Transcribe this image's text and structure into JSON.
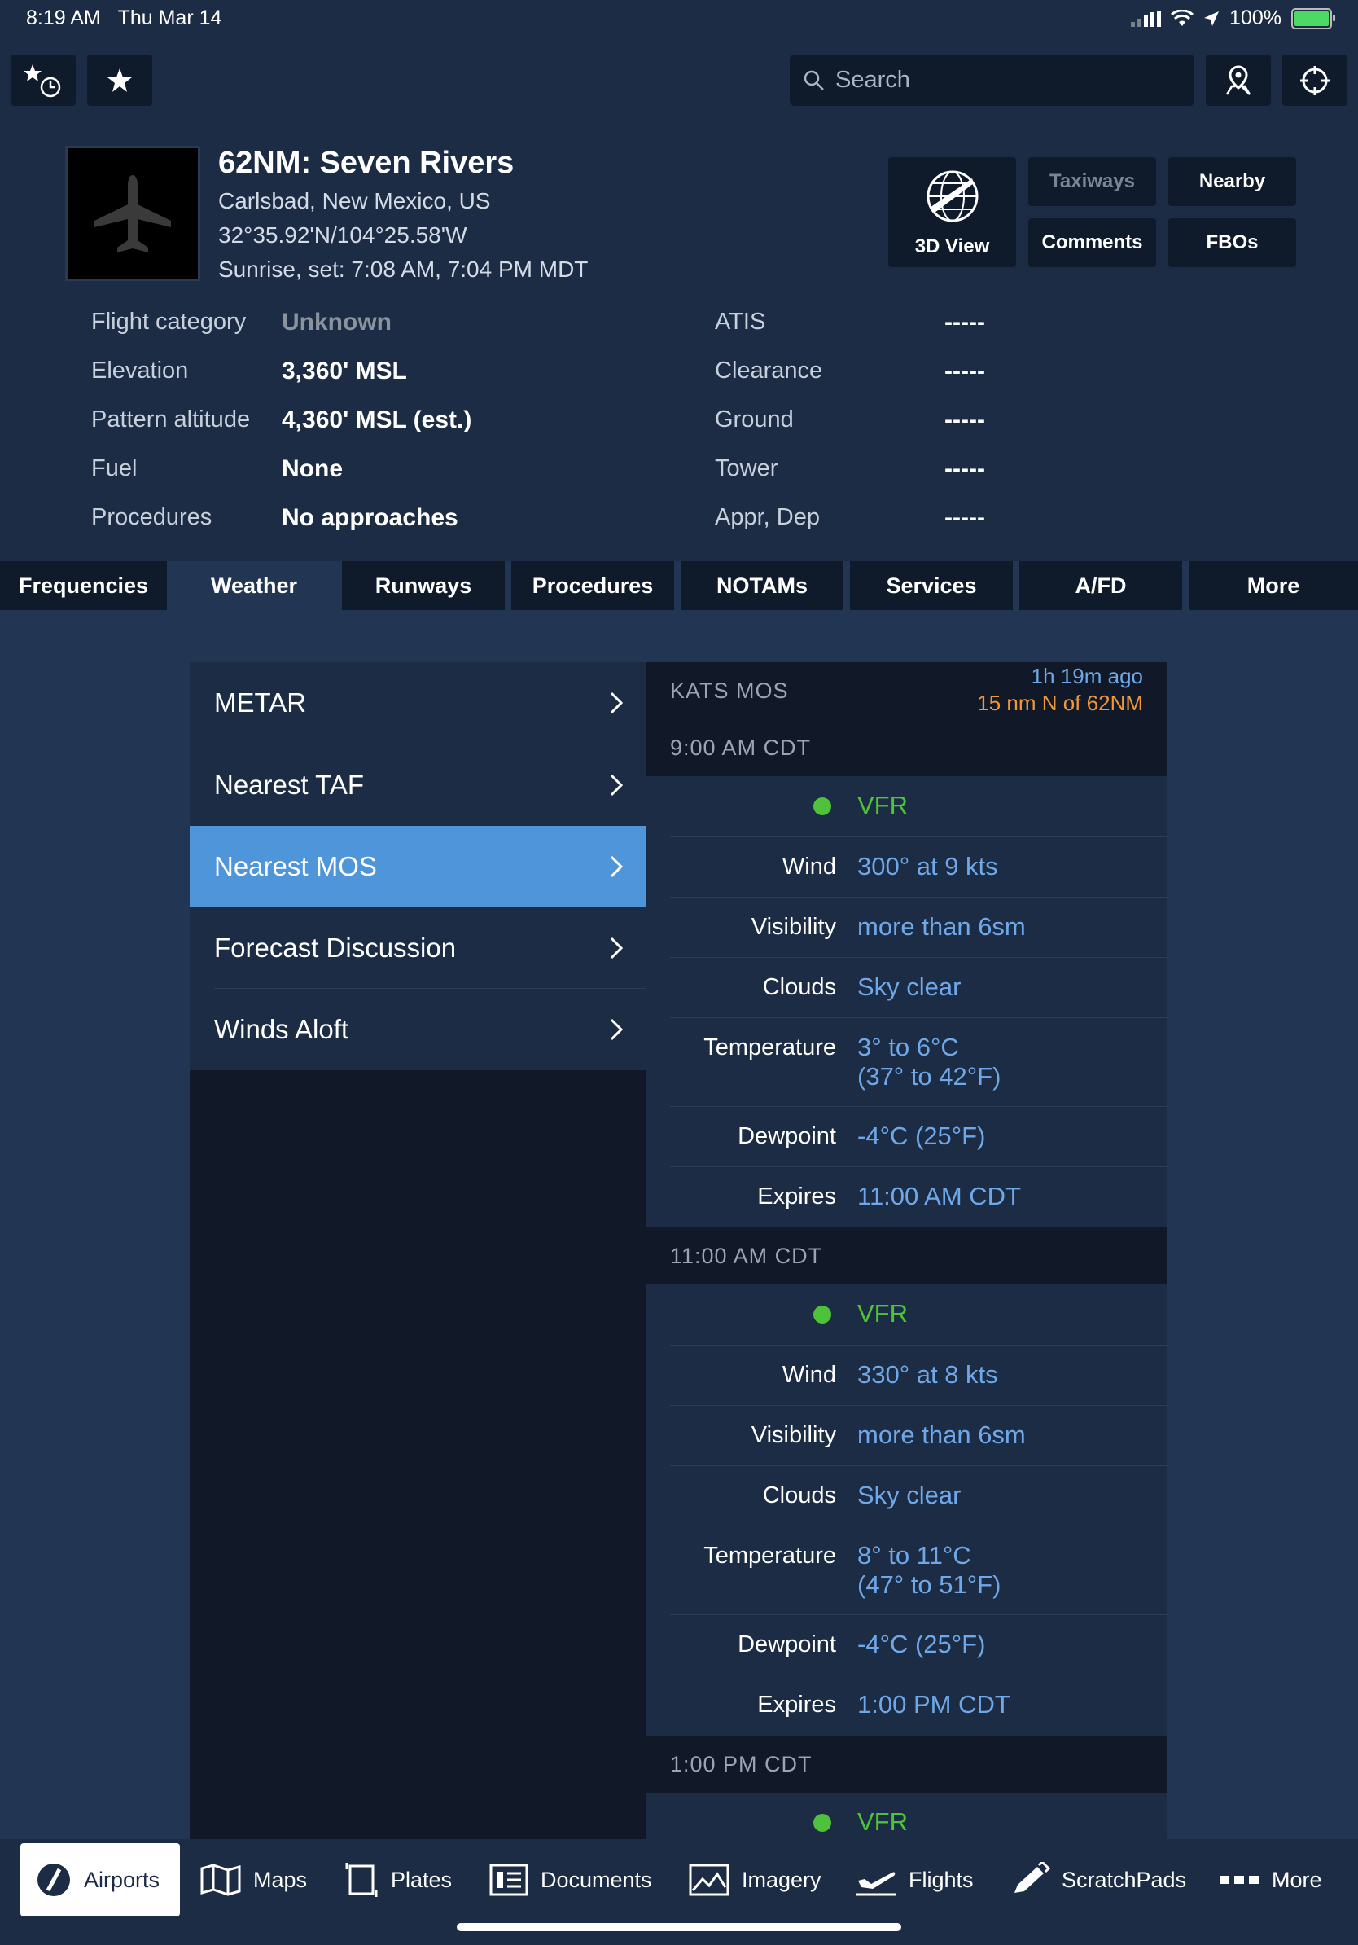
{
  "status": {
    "time": "8:19 AM",
    "date": "Thu Mar 14",
    "battery": "100%"
  },
  "toolbar": {
    "search_placeholder": "Search"
  },
  "airport": {
    "title": "62NM: Seven Rivers",
    "location": "Carlsbad, New Mexico, US",
    "coords": "32°35.92'N/104°25.58'W",
    "sun": "Sunrise, set: 7:08 AM, 7:04 PM MDT"
  },
  "header_buttons": {
    "view3d": "3D View",
    "taxiways": "Taxiways",
    "nearby": "Nearby",
    "comments": "Comments",
    "fbos": "FBOs"
  },
  "info_left": [
    {
      "label": "Flight category",
      "value": "Unknown"
    },
    {
      "label": "Elevation",
      "value": "3,360' MSL"
    },
    {
      "label": "Pattern altitude",
      "value": "4,360' MSL (est.)"
    },
    {
      "label": "Fuel",
      "value": "None"
    },
    {
      "label": "Procedures",
      "value": "No approaches"
    }
  ],
  "info_right": [
    {
      "label": "ATIS",
      "value": "-----"
    },
    {
      "label": "Clearance",
      "value": "-----"
    },
    {
      "label": "Ground",
      "value": "-----"
    },
    {
      "label": "Tower",
      "value": "-----"
    },
    {
      "label": "Appr, Dep",
      "value": "-----"
    }
  ],
  "tabs": [
    "Frequencies",
    "Weather",
    "Runways",
    "Procedures",
    "NOTAMs",
    "Services",
    "A/FD",
    "More"
  ],
  "weather_menu": [
    "METAR",
    "Nearest TAF",
    "Nearest MOS",
    "Forecast Discussion",
    "Winds Aloft"
  ],
  "mos": {
    "station": "KATS MOS",
    "age": "1h 19m ago",
    "distance": "15 nm N of 62NM",
    "periods": [
      {
        "time": "9:00 AM CDT",
        "category": "VFR",
        "wind": "300° at 9 kts",
        "visibility": "more than 6sm",
        "clouds": "Sky clear",
        "temp1": "3° to 6°C",
        "temp2": "(37° to 42°F)",
        "dewpoint": "-4°C (25°F)",
        "expires": "11:00 AM CDT"
      },
      {
        "time": "11:00 AM CDT",
        "category": "VFR",
        "wind": "330° at 8 kts",
        "visibility": "more than 6sm",
        "clouds": "Sky clear",
        "temp1": "8° to 11°C",
        "temp2": "(47° to 51°F)",
        "dewpoint": "-4°C (25°F)",
        "expires": "1:00 PM CDT"
      },
      {
        "time": "1:00 PM CDT",
        "category": "VFR"
      }
    ],
    "labels": {
      "wind": "Wind",
      "visibility": "Visibility",
      "clouds": "Clouds",
      "temperature": "Temperature",
      "dewpoint": "Dewpoint",
      "expires": "Expires"
    }
  },
  "bottom_nav": [
    "Airports",
    "Maps",
    "Plates",
    "Documents",
    "Imagery",
    "Flights",
    "ScratchPads",
    "More"
  ]
}
